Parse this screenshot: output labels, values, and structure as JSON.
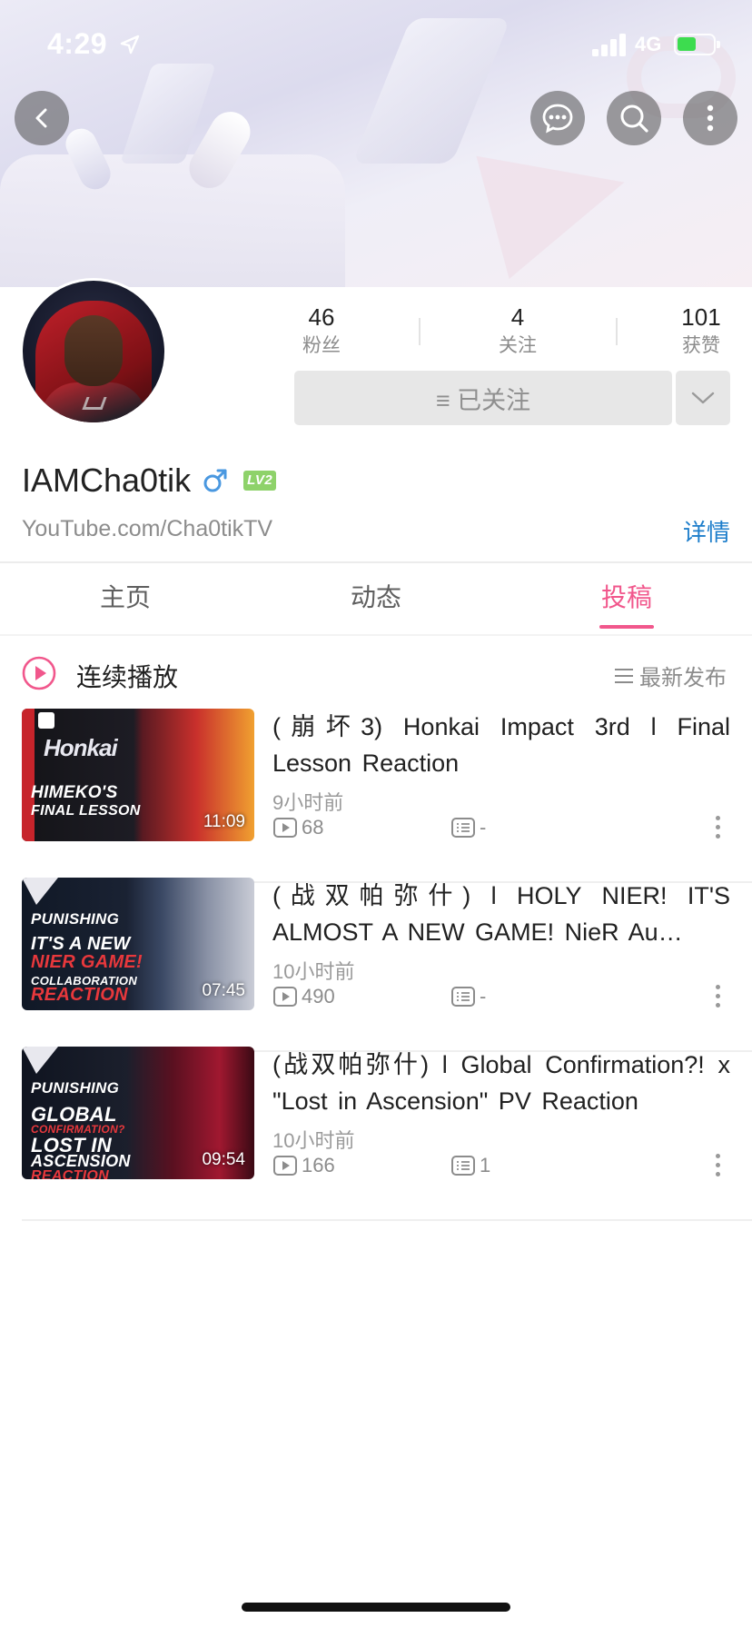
{
  "status_bar": {
    "time": "4:29",
    "network": "4G"
  },
  "colors": {
    "accent": "#f1578c",
    "link": "#1e7ecb",
    "level_badge": "#8ed26a",
    "battery": "#3ddc4f"
  },
  "header": {
    "icons": [
      "back-arrow-icon",
      "message-icon",
      "search-icon",
      "more-vertical-icon"
    ]
  },
  "profile": {
    "stats": [
      {
        "value": "46",
        "label": "粉丝"
      },
      {
        "value": "4",
        "label": "关注"
      },
      {
        "value": "101",
        "label": "获赞"
      }
    ],
    "follow_button": "≡ 已关注",
    "username": "IAMCha0tik",
    "gender": "male",
    "level_badge": "LV2",
    "bio": "YouTube.com/Cha0tikTV",
    "details_link": "详情"
  },
  "tabs": [
    {
      "label": "主页",
      "active": false
    },
    {
      "label": "动态",
      "active": false
    },
    {
      "label": "投稿",
      "active": true
    }
  ],
  "list_header": {
    "play_all": "连续播放",
    "sort": "最新发布"
  },
  "videos": [
    {
      "title": "(崩坏3) Honkai Impact 3rd l Final Lesson Reaction",
      "time": "9小时前",
      "plays": "68",
      "comments": "-",
      "duration": "11:09",
      "thumb_lines": [
        "HIMEKO'S",
        "FINAL LESSON"
      ]
    },
    {
      "title": "(战双帕弥什) l HOLY NIER! IT'S ALMOST A NEW GAME! NieR Au…",
      "time": "10小时前",
      "plays": "490",
      "comments": "-",
      "duration": "07:45",
      "thumb_lines": [
        "PUNISHING",
        "IT'S A NEW",
        "NIER GAME!",
        "COLLABORATION",
        "REACTION"
      ]
    },
    {
      "title": "(战双帕弥什) l Global Confirmation?! x \"Lost in Ascension\" PV Reaction",
      "time": "10小时前",
      "plays": "166",
      "comments": "1",
      "duration": "09:54",
      "thumb_lines": [
        "PUNISHING",
        "GLOBAL",
        "CONFIRMATION?",
        "LOST IN",
        "ASCENSION",
        "REACTION"
      ]
    }
  ]
}
